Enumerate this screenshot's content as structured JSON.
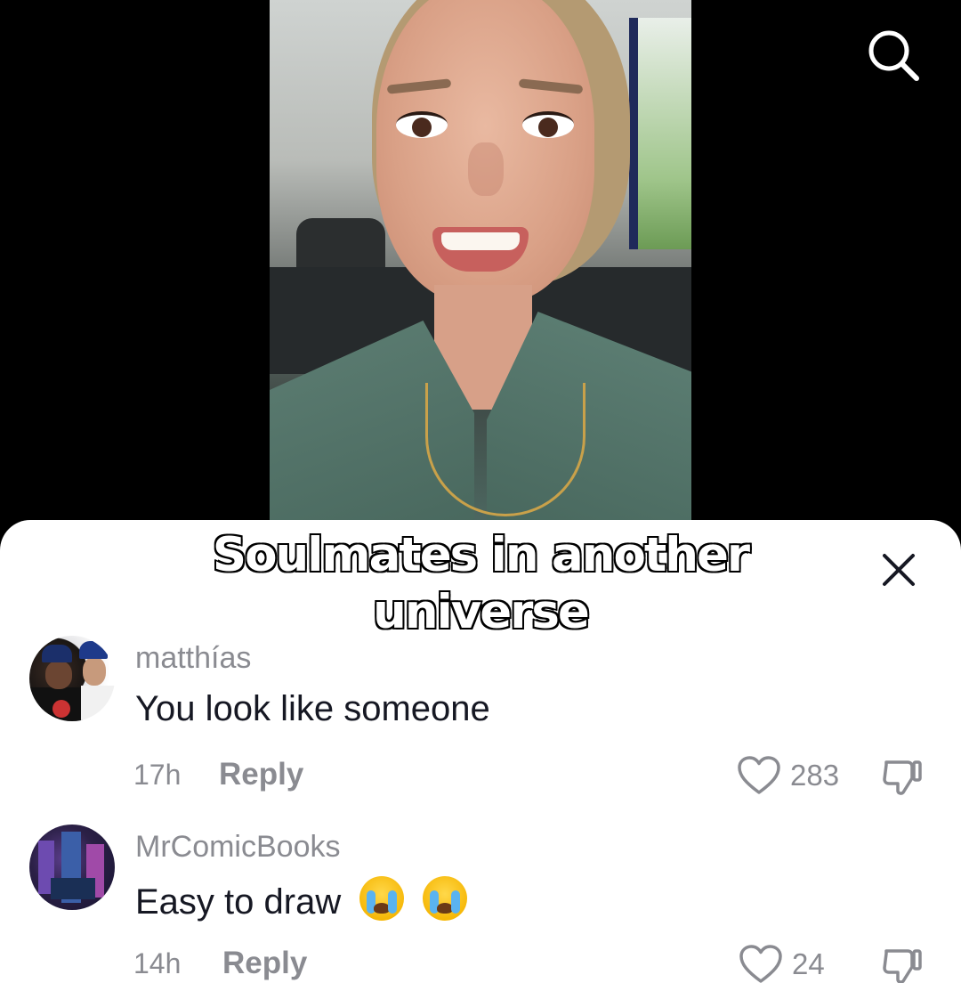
{
  "video": {
    "caption": "Soulmates in another universe"
  },
  "header": {
    "search_icon": "search-icon"
  },
  "sheet": {
    "close_icon": "close-icon"
  },
  "comments": [
    {
      "username": "matthías",
      "text": "You look like someone",
      "time": "17h",
      "reply_label": "Reply",
      "likes": "283"
    },
    {
      "username": "MrComicBooks",
      "text": "Easy to draw",
      "emojis": [
        "loudly-crying-face",
        "loudly-crying-face"
      ],
      "time": "14h",
      "reply_label": "Reply",
      "likes": "24"
    }
  ]
}
